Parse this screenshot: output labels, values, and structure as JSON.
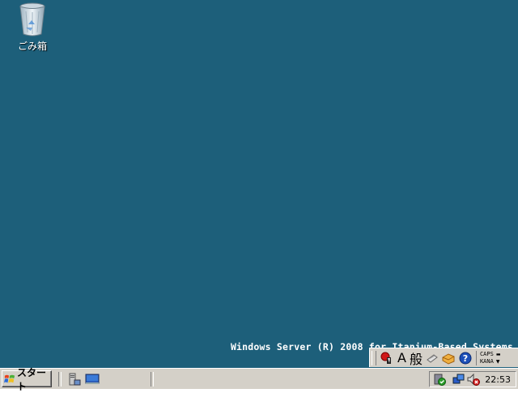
{
  "desktop": {
    "background_color": "#1d5f7a",
    "icons": [
      {
        "label": "ごみ箱",
        "icon": "recycle-bin-icon"
      }
    ],
    "watermark": "Windows Server (R) 2008 for Itanium-Based Systems"
  },
  "language_bar": {
    "ime_icon": "ime-pad-icon",
    "input_mode": "A",
    "conversion_mode": "般",
    "tools_icon": "tools-icon",
    "dictionary_icon": "dictionary-icon",
    "help_icon": "help-icon",
    "caps_label": "CAPS",
    "kana_label": "KANA"
  },
  "taskbar": {
    "start_label": "スタート",
    "quick_launch": [
      {
        "icon": "server-manager-icon"
      },
      {
        "icon": "show-desktop-icon"
      }
    ],
    "tray": {
      "icons": [
        "security-shield-icon",
        "network-icon",
        "volume-muted-icon"
      ],
      "clock": "22:53"
    }
  }
}
